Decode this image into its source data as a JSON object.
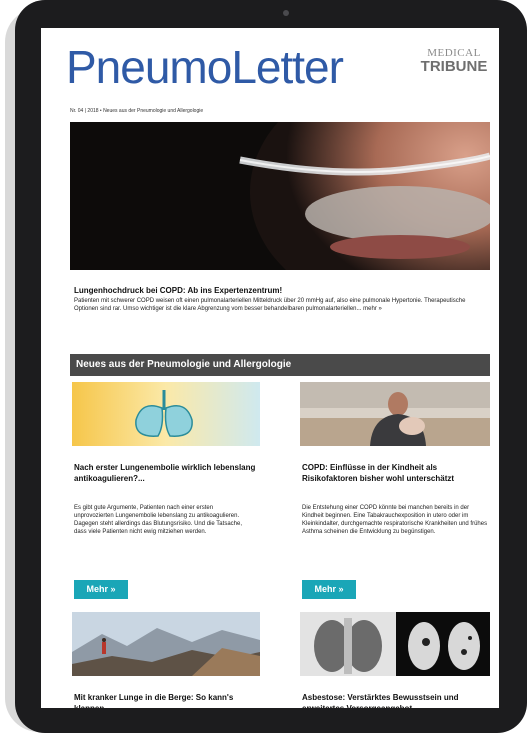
{
  "header": {
    "logo": "PneumoLetter",
    "brand_line1": "MEDICAL",
    "brand_line2": "TRIBUNE",
    "issue": "Nr. 04 | 2018 • Neues aus der Pneumologie und Allergologie"
  },
  "featured": {
    "title": "Lungenhochdruck bei COPD: Ab ins Expertenzentrum!",
    "text": "Patienten mit schwerer COPD weisen oft einen pulmonalarteriellen Mitteldruck über 20 mmHg auf, also eine pulmonale Hypertonie. Therapeutische Optionen sind rar. Umso wichtiger ist die klare Abgrenzung vom besser behandelbaren pulmonalarteriellen... mehr »"
  },
  "section": {
    "title": "Neues aus der Pneumologie und Allergologie"
  },
  "articles": [
    {
      "title": "Nach erster Lungenembolie wirklich lebenslang antikoagulieren?...",
      "text": "Es gibt gute Argumente, Patienten nach einer ersten unprovozierten Lungenembolie lebenslang zu antikoagulieren. Dagegen steht allerdings das Blutungsrisiko. Und die Tatsache, dass viele Patienten nicht ewig mitziehen werden.",
      "button": "Mehr »"
    },
    {
      "title": "COPD: Einflüsse in der Kindheit als Risikofaktoren bisher wohl unterschätzt",
      "text": "Die Entstehung einer COPD könnte bei manchen bereits in der Kindheit beginnen. Eine Tabakrauchexposition in utero oder im Kleinkindalter, durchgemachte respiratorische Krankheiten und frühes Asthma scheinen die Entwicklung zu begünstigen.",
      "button": "Mehr »"
    },
    {
      "title": "Mit kranker Lunge in die Berge: So kann's klappen"
    },
    {
      "title": "Asbestose: Verstärktes Bewusstsein und erweitertes Vorsorgeangebot"
    }
  ],
  "colors": {
    "logo": "#2f5aa6",
    "button": "#1aa6b7",
    "section_bar": "#4a4a4a",
    "device": "#1c1c1e"
  }
}
